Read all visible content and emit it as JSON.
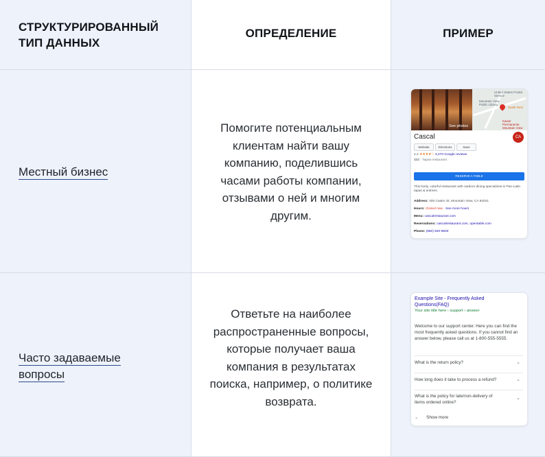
{
  "headers": {
    "type": "СТРУКТУРИРОВАННЫЙ ТИП ДАННЫХ",
    "definition": "ОПРЕДЕЛЕНИЕ",
    "example": "ПРИМЕР"
  },
  "rows": [
    {
      "type": "Местный бизнес",
      "definition": "Помогите потенциальным клиентам найти вашу компанию, поделившись часами работы компании, отзывами о ней и многим другим.",
      "example": {
        "name": "Cascal",
        "logo_text": "CA",
        "see_photos": "See photos",
        "map_labels": [
          "United States Postal Service",
          "Mountain View Public Library",
          "Sushi Tomi",
          "Kaiser Permanente Mountain View"
        ],
        "buttons": [
          "Website",
          "Directions",
          "Save"
        ],
        "rating": "4.2",
        "stars": "★★★★☆",
        "reviews": "3,270 Google reviews",
        "price_category": "$$$ · Tapas restaurant",
        "reserve": "RESERVE A TABLE",
        "description": "This lively, colorful restaurant with outdoor dining specializes in Pan-Latin tapas & entrees.",
        "address_label": "Address:",
        "address": "400 Castro St, Mountain View, CA 94041",
        "hours_label": "Hours:",
        "hours_status": "Closed now",
        "hours_more": "See more hours",
        "menu_label": "Menu:",
        "menu": "cascalrestaurant.com",
        "reservations_label": "Reservations:",
        "reservations": "cascalrestaurant.com, opentable.com",
        "phone_label": "Phone:",
        "phone": "(650) 940-9500"
      }
    },
    {
      "type": "Часто задаваемые вопросы",
      "definition": "Ответьте на наиболее распространенные вопросы, которые получает ваша компания в результатах поиска, например, о политике возврата.",
      "example": {
        "title": "Example Site - Frequently Asked Questions(FAQ)",
        "breadcrumb": "Your site title here › support › answer",
        "snippet": "Welcome to our support center. Here you can find the most frequently asked questions. If you cannot find an answer below, please call us at 1-800-555-5555.",
        "questions": [
          "What is the return policy?",
          "How long does it take to process a refund?",
          "What is the policy for late/non-delivery of items ordered online?"
        ],
        "show_more": "Show more"
      }
    }
  ],
  "colors": {
    "blue_cell": "#eef2fb",
    "border": "#d7dce6",
    "link_underline": "#2b4a8a",
    "google_blue": "#1a73e8"
  }
}
